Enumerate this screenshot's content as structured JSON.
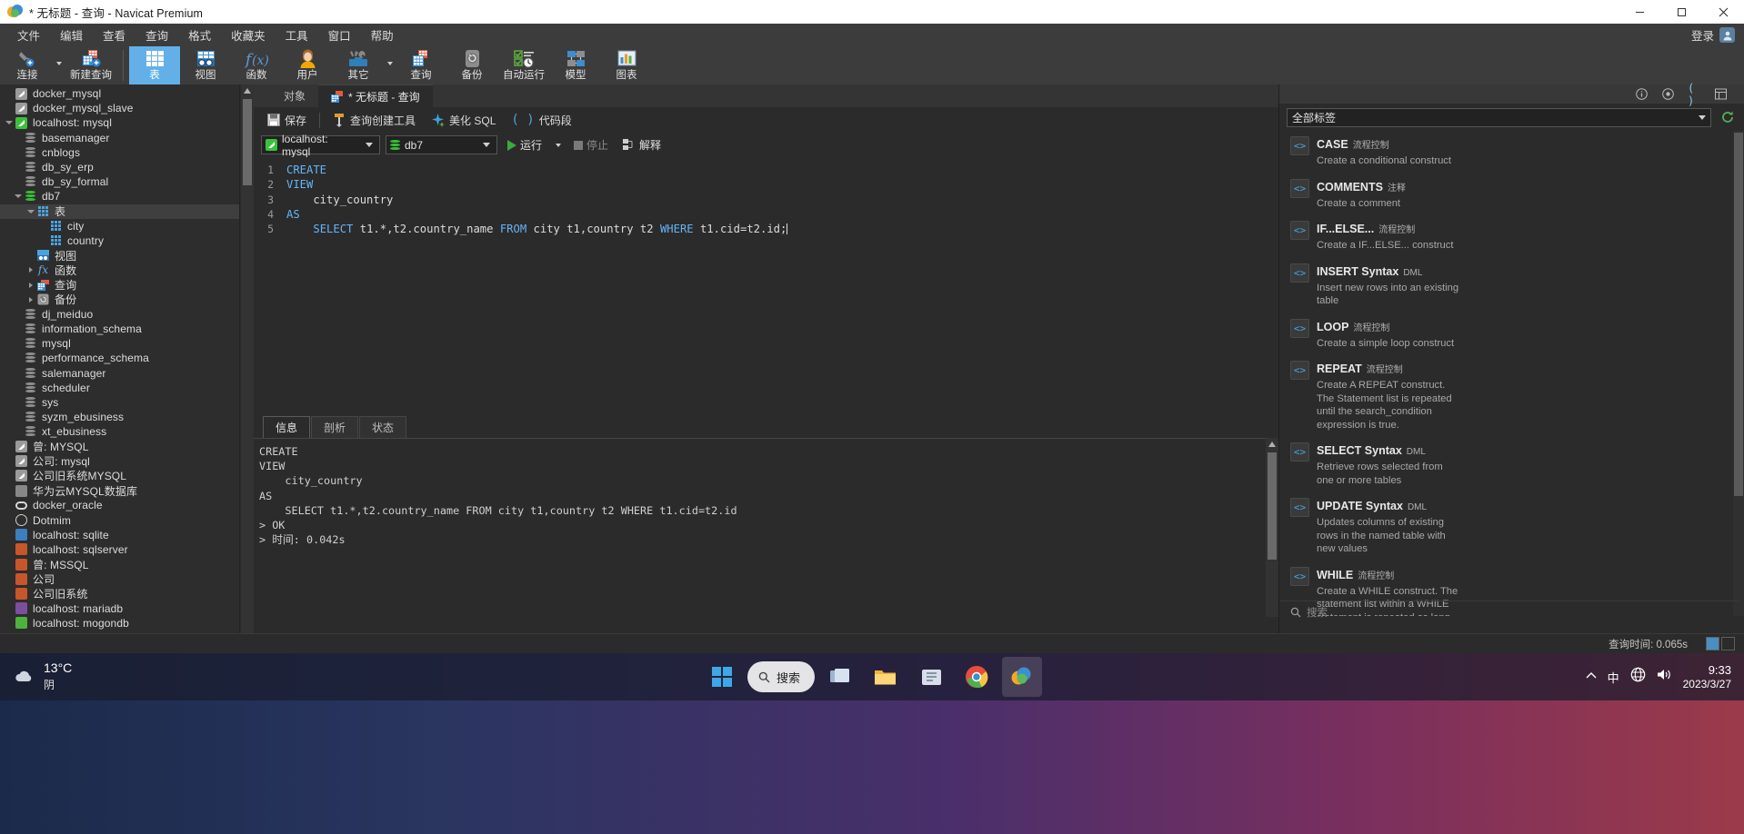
{
  "window": {
    "title": "* 无标题 - 查询 - Navicat Premium",
    "minimize": "minimize-icon",
    "maximize": "maximize-icon",
    "close": "close-icon"
  },
  "menubar": {
    "items": [
      "文件",
      "编辑",
      "查看",
      "查询",
      "格式",
      "收藏夹",
      "工具",
      "窗口",
      "帮助"
    ],
    "login_label": "登录"
  },
  "toolbar": {
    "buttons": [
      {
        "label": "连接",
        "icon": "connection-icon",
        "has_caret": true,
        "active": false
      },
      {
        "label": "新建查询",
        "icon": "new-query-icon",
        "has_caret": false,
        "active": false
      },
      {
        "label": "表",
        "icon": "table-icon",
        "has_caret": false,
        "active": true
      },
      {
        "label": "视图",
        "icon": "view-icon",
        "has_caret": false,
        "active": false
      },
      {
        "label": "函数",
        "icon": "function-icon",
        "has_caret": false,
        "active": false
      },
      {
        "label": "用户",
        "icon": "user-icon",
        "has_caret": false,
        "active": false
      },
      {
        "label": "其它",
        "icon": "other-tools-icon",
        "has_caret": true,
        "active": false
      },
      {
        "label": "查询",
        "icon": "query-icon",
        "has_caret": false,
        "active": false
      },
      {
        "label": "备份",
        "icon": "backup-icon",
        "has_caret": false,
        "active": false
      },
      {
        "label": "自动运行",
        "icon": "automation-icon",
        "has_caret": false,
        "active": false
      },
      {
        "label": "模型",
        "icon": "model-icon",
        "has_caret": false,
        "active": false
      },
      {
        "label": "图表",
        "icon": "chart-icon",
        "has_caret": false,
        "active": false
      }
    ]
  },
  "sidebar": {
    "items": [
      {
        "label": "docker_mysql",
        "indent": 0,
        "icon": "connection-gray",
        "twist": "none",
        "selected": false
      },
      {
        "label": "docker_mysql_slave",
        "indent": 0,
        "icon": "connection-gray",
        "twist": "none",
        "selected": false
      },
      {
        "label": "localhost: mysql",
        "indent": 0,
        "icon": "connection-green",
        "twist": "open",
        "selected": false
      },
      {
        "label": "basemanager",
        "indent": 1,
        "icon": "db-gray",
        "twist": "none",
        "selected": false
      },
      {
        "label": "cnblogs",
        "indent": 1,
        "icon": "db-gray",
        "twist": "none",
        "selected": false
      },
      {
        "label": "db_sy_erp",
        "indent": 1,
        "icon": "db-gray",
        "twist": "none",
        "selected": false
      },
      {
        "label": "db_sy_formal",
        "indent": 1,
        "icon": "db-gray",
        "twist": "none",
        "selected": false
      },
      {
        "label": "db7",
        "indent": 1,
        "icon": "db-green",
        "twist": "open",
        "selected": false
      },
      {
        "label": "表",
        "indent": 2,
        "icon": "table-blue",
        "twist": "open",
        "selected": true
      },
      {
        "label": "city",
        "indent": 3,
        "icon": "table-blue",
        "twist": "none",
        "selected": false
      },
      {
        "label": "country",
        "indent": 3,
        "icon": "table-blue",
        "twist": "none",
        "selected": false
      },
      {
        "label": "视图",
        "indent": 2,
        "icon": "view-blue",
        "twist": "none",
        "selected": false
      },
      {
        "label": "函数",
        "indent": 2,
        "icon": "function-fx",
        "twist": "closed",
        "selected": false
      },
      {
        "label": "查询",
        "indent": 2,
        "icon": "query-red",
        "twist": "closed",
        "selected": false
      },
      {
        "label": "备份",
        "indent": 2,
        "icon": "backup-gray",
        "twist": "closed",
        "selected": false
      },
      {
        "label": "dj_meiduo",
        "indent": 1,
        "icon": "db-gray",
        "twist": "none",
        "selected": false
      },
      {
        "label": "information_schema",
        "indent": 1,
        "icon": "db-gray",
        "twist": "none",
        "selected": false
      },
      {
        "label": "mysql",
        "indent": 1,
        "icon": "db-gray",
        "twist": "none",
        "selected": false
      },
      {
        "label": "performance_schema",
        "indent": 1,
        "icon": "db-gray",
        "twist": "none",
        "selected": false
      },
      {
        "label": "salemanager",
        "indent": 1,
        "icon": "db-gray",
        "twist": "none",
        "selected": false
      },
      {
        "label": "scheduler",
        "indent": 1,
        "icon": "db-gray",
        "twist": "none",
        "selected": false
      },
      {
        "label": "sys",
        "indent": 1,
        "icon": "db-gray",
        "twist": "none",
        "selected": false
      },
      {
        "label": "syzm_ebusiness",
        "indent": 1,
        "icon": "db-gray",
        "twist": "none",
        "selected": false
      },
      {
        "label": "xt_ebusiness",
        "indent": 1,
        "icon": "db-gray",
        "twist": "none",
        "selected": false
      },
      {
        "label": "曾: MYSQL",
        "indent": 0,
        "icon": "connection-gray",
        "twist": "none",
        "selected": false
      },
      {
        "label": "公司: mysql",
        "indent": 0,
        "icon": "connection-gray",
        "twist": "none",
        "selected": false
      },
      {
        "label": "公司旧系统MYSQL",
        "indent": 0,
        "icon": "connection-gray",
        "twist": "none",
        "selected": false
      },
      {
        "label": "华为云MYSQL数据库",
        "indent": 0,
        "icon": "huawei-cloud",
        "twist": "none",
        "selected": false
      },
      {
        "label": "docker_oracle",
        "indent": 0,
        "icon": "oracle",
        "twist": "none",
        "selected": false
      },
      {
        "label": "Dotmim",
        "indent": 0,
        "icon": "dot-circle",
        "twist": "none",
        "selected": false
      },
      {
        "label": "localhost: sqlite",
        "indent": 0,
        "icon": "sqlite",
        "twist": "none",
        "selected": false
      },
      {
        "label": "localhost: sqlserver",
        "indent": 0,
        "icon": "mssql",
        "twist": "none",
        "selected": false
      },
      {
        "label": "曾: MSSQL",
        "indent": 0,
        "icon": "mssql",
        "twist": "none",
        "selected": false
      },
      {
        "label": "公司",
        "indent": 0,
        "icon": "mssql",
        "twist": "none",
        "selected": false
      },
      {
        "label": "公司旧系统",
        "indent": 0,
        "icon": "mssql",
        "twist": "none",
        "selected": false
      },
      {
        "label": "localhost: mariadb",
        "indent": 0,
        "icon": "mariadb",
        "twist": "none",
        "selected": false
      },
      {
        "label": "localhost: mogondb",
        "indent": 0,
        "icon": "mongodb",
        "twist": "none",
        "selected": false
      }
    ]
  },
  "main": {
    "tabs": [
      {
        "label": "对象",
        "icon": "objects-icon",
        "active": false
      },
      {
        "label": "* 无标题 - 查询",
        "icon": "query-icon",
        "active": true
      }
    ],
    "query_toolbar": [
      {
        "label": "保存",
        "icon": "save-icon"
      },
      {
        "label": "查询创建工具",
        "icon": "query-builder-icon"
      },
      {
        "label": "美化 SQL",
        "icon": "beautify-sql-icon"
      },
      {
        "label": "代码段",
        "icon": "snippet-icon"
      }
    ],
    "connection_select": {
      "value": "localhost: mysql",
      "icon": "connection-green"
    },
    "database_select": {
      "value": "db7",
      "icon": "db-green"
    },
    "run_label": "运行",
    "stop_label": "停止",
    "explain_label": "解释",
    "code_lines": [
      {
        "n": "1",
        "tokens": [
          {
            "t": "CREATE",
            "c": "k"
          }
        ]
      },
      {
        "n": "2",
        "tokens": [
          {
            "t": "VIEW",
            "c": "k"
          }
        ]
      },
      {
        "n": "3",
        "tokens": [
          {
            "t": "    city_country",
            "c": "plain"
          }
        ]
      },
      {
        "n": "4",
        "tokens": [
          {
            "t": "AS",
            "c": "k"
          }
        ]
      },
      {
        "n": "5",
        "tokens": [
          {
            "t": "    ",
            "c": "plain"
          },
          {
            "t": "SELECT",
            "c": "k"
          },
          {
            "t": " t1.*,t2.country_name ",
            "c": "plain"
          },
          {
            "t": "FROM",
            "c": "k"
          },
          {
            "t": " city t1,country t2 ",
            "c": "plain"
          },
          {
            "t": "WHERE",
            "c": "k"
          },
          {
            "t": " t1.cid=t2.id;",
            "c": "plain"
          }
        ]
      }
    ],
    "result_tabs": [
      {
        "label": "信息",
        "active": true
      },
      {
        "label": "剖析",
        "active": false
      },
      {
        "label": "状态",
        "active": false
      }
    ],
    "result_text": "CREATE\nVIEW\n    city_country\nAS\n    SELECT t1.*,t2.country_name FROM city t1,country t2 WHERE t1.cid=t2.id\n> OK\n> 时间: 0.042s"
  },
  "right_panel": {
    "header_icons": [
      "info-icon",
      "help-icon",
      "code-icon",
      "list-icon"
    ],
    "filter_value": "全部标签",
    "refresh_icon": "refresh-icon",
    "search_placeholder": "搜索",
    "snippets": [
      {
        "title": "CASE",
        "tag": "流程控制",
        "desc": "Create a conditional construct",
        "icon": "code-snippet-icon"
      },
      {
        "title": "COMMENTS",
        "tag": "注释",
        "desc": "Create a comment",
        "icon": "code-snippet-icon"
      },
      {
        "title": "IF...ELSE...",
        "tag": "流程控制",
        "desc": "Create a IF...ELSE... construct",
        "icon": "code-snippet-icon"
      },
      {
        "title": "INSERT Syntax",
        "tag": "DML",
        "desc": "Insert new rows into an existing table",
        "icon": "code-snippet-icon"
      },
      {
        "title": "LOOP",
        "tag": "流程控制",
        "desc": "Create a simple loop construct",
        "icon": "code-snippet-icon"
      },
      {
        "title": "REPEAT",
        "tag": "流程控制",
        "desc": "Create A REPEAT construct. The Statement list is repeated until the search_condition expression is true.",
        "icon": "code-snippet-icon"
      },
      {
        "title": "SELECT Syntax",
        "tag": "DML",
        "desc": "Retrieve rows selected from one or more tables",
        "icon": "code-snippet-icon"
      },
      {
        "title": "UPDATE Syntax",
        "tag": "DML",
        "desc": "Updates columns of existing rows in the named table with new values",
        "icon": "code-snippet-icon"
      },
      {
        "title": "WHILE",
        "tag": "流程控制",
        "desc": "Create a WHILE construct. The statement list within a WHILE statement is repeated as long as the search_condition expression is true.",
        "icon": "code-snippet-icon"
      }
    ]
  },
  "statusbar": {
    "query_time": "查询时间: 0.065s"
  },
  "taskbar": {
    "weather_temp": "13°C",
    "weather_desc": "阴",
    "search_placeholder": "搜索",
    "ime_label": "中",
    "clock_time": "9:33",
    "clock_date": "2023/3/27"
  },
  "colors": {
    "accent_blue": "#63b0e8",
    "keyword_blue": "#64b5f6",
    "green": "#3fa83f",
    "panel_dark": "#2b2b2b",
    "chrome": "#3c3c3c"
  }
}
